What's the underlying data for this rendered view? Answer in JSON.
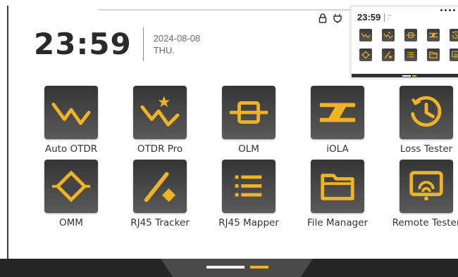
{
  "clock": {
    "time": "23:59",
    "date": "2024-08-08",
    "weekday": "THU."
  },
  "status_icons": [
    "lock-icon",
    "power-plug-icon"
  ],
  "accent_color": "#f0b323",
  "apps": [
    {
      "label": "Auto OTDR",
      "icon": "auto-otdr-icon"
    },
    {
      "label": "OTDR Pro",
      "icon": "otdr-pro-icon"
    },
    {
      "label": "OLM",
      "icon": "olm-icon"
    },
    {
      "label": "iOLA",
      "icon": "iola-icon"
    },
    {
      "label": "Loss Tester",
      "icon": "loss-tester-icon"
    },
    {
      "label": "OMM",
      "icon": "omm-icon"
    },
    {
      "label": "RJ45 Tracker",
      "icon": "rj45-tracker-icon"
    },
    {
      "label": "RJ45 Mapper",
      "icon": "rj45-mapper-icon"
    },
    {
      "label": "File Manager",
      "icon": "file-manager-icon"
    },
    {
      "label": "Remote Tester",
      "icon": "remote-tester-icon"
    }
  ],
  "preview": {
    "time": "23:59"
  },
  "pager": {
    "pages": 2,
    "current": 1
  }
}
